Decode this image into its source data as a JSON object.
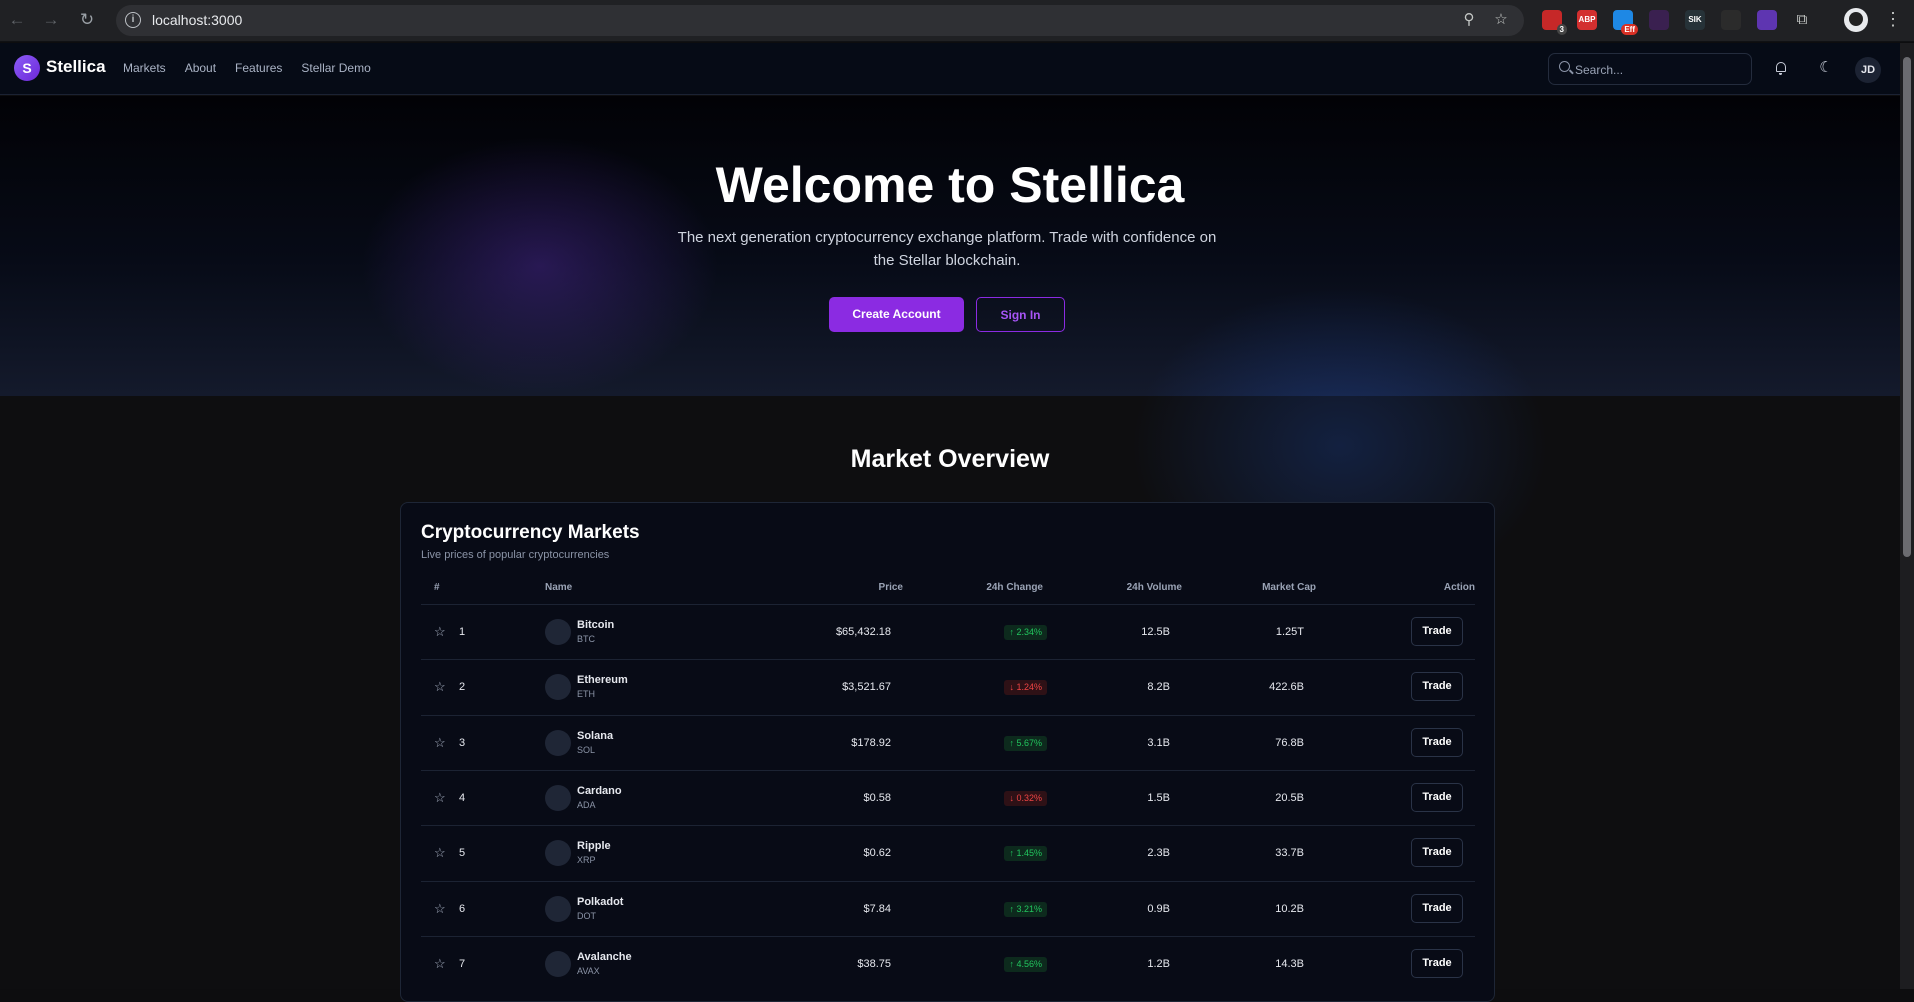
{
  "browser": {
    "url": "localhost:3000",
    "extensions": [
      {
        "name": "ext-1",
        "color": "#c62828",
        "badge": "3",
        "badge_red": false
      },
      {
        "name": "adblock-plus",
        "label": "ABP",
        "color": "#d32f2f",
        "badge": "",
        "badge_red": false
      },
      {
        "name": "ext-3",
        "color": "#1e88e5",
        "badge": "Eff",
        "badge_red": true
      },
      {
        "name": "ext-4",
        "color": "#3a2050",
        "badge": "",
        "badge_red": false
      },
      {
        "name": "ext-5",
        "label": "SIK",
        "color": "#263238",
        "badge": "",
        "badge_red": false
      },
      {
        "name": "ext-6",
        "color": "#2b2b2b",
        "badge": "",
        "badge_red": false
      },
      {
        "name": "ext-7",
        "color": "#5e35b1",
        "badge": "",
        "badge_red": false
      }
    ]
  },
  "header": {
    "logo_letter": "S",
    "brand": "Stellica",
    "nav": [
      "Markets",
      "About",
      "Features",
      "Stellar Demo"
    ],
    "search_placeholder": "Search...",
    "user_initials": "JD"
  },
  "hero": {
    "title": "Welcome to Stellica",
    "subtitle": "The next generation cryptocurrency exchange platform. Trade with confidence on the Stellar blockchain.",
    "primary_cta": "Create Account",
    "secondary_cta": "Sign In"
  },
  "market": {
    "section_title": "Market Overview",
    "card_title": "Cryptocurrency Markets",
    "card_subtitle": "Live prices of popular cryptocurrencies",
    "columns": {
      "rank": "#",
      "name": "Name",
      "price": "Price",
      "change": "24h Change",
      "volume": "24h Volume",
      "cap": "Market Cap",
      "action": "Action"
    },
    "rows": [
      {
        "rank": "1",
        "name": "Bitcoin",
        "symbol": "BTC",
        "price": "$65,432.18",
        "change": "↑ 2.34%",
        "dir": "up",
        "volume": "12.5B",
        "cap": "1.25T",
        "action": "Trade"
      },
      {
        "rank": "2",
        "name": "Ethereum",
        "symbol": "ETH",
        "price": "$3,521.67",
        "change": "↓ 1.24%",
        "dir": "down",
        "volume": "8.2B",
        "cap": "422.6B",
        "action": "Trade"
      },
      {
        "rank": "3",
        "name": "Solana",
        "symbol": "SOL",
        "price": "$178.92",
        "change": "↑ 5.67%",
        "dir": "up",
        "volume": "3.1B",
        "cap": "76.8B",
        "action": "Trade"
      },
      {
        "rank": "4",
        "name": "Cardano",
        "symbol": "ADA",
        "price": "$0.58",
        "change": "↓ 0.32%",
        "dir": "down",
        "volume": "1.5B",
        "cap": "20.5B",
        "action": "Trade"
      },
      {
        "rank": "5",
        "name": "Ripple",
        "symbol": "XRP",
        "price": "$0.62",
        "change": "↑ 1.45%",
        "dir": "up",
        "volume": "2.3B",
        "cap": "33.7B",
        "action": "Trade"
      },
      {
        "rank": "6",
        "name": "Polkadot",
        "symbol": "DOT",
        "price": "$7.84",
        "change": "↑ 3.21%",
        "dir": "up",
        "volume": "0.9B",
        "cap": "10.2B",
        "action": "Trade"
      },
      {
        "rank": "7",
        "name": "Avalanche",
        "symbol": "AVAX",
        "price": "$38.75",
        "change": "↑ 4.56%",
        "dir": "up",
        "volume": "1.2B",
        "cap": "14.3B",
        "action": "Trade"
      }
    ]
  },
  "colors": {
    "accent": "#8b2be2",
    "positive": "#22c55e",
    "negative": "#ef4444",
    "header_bg": "#060b16"
  }
}
